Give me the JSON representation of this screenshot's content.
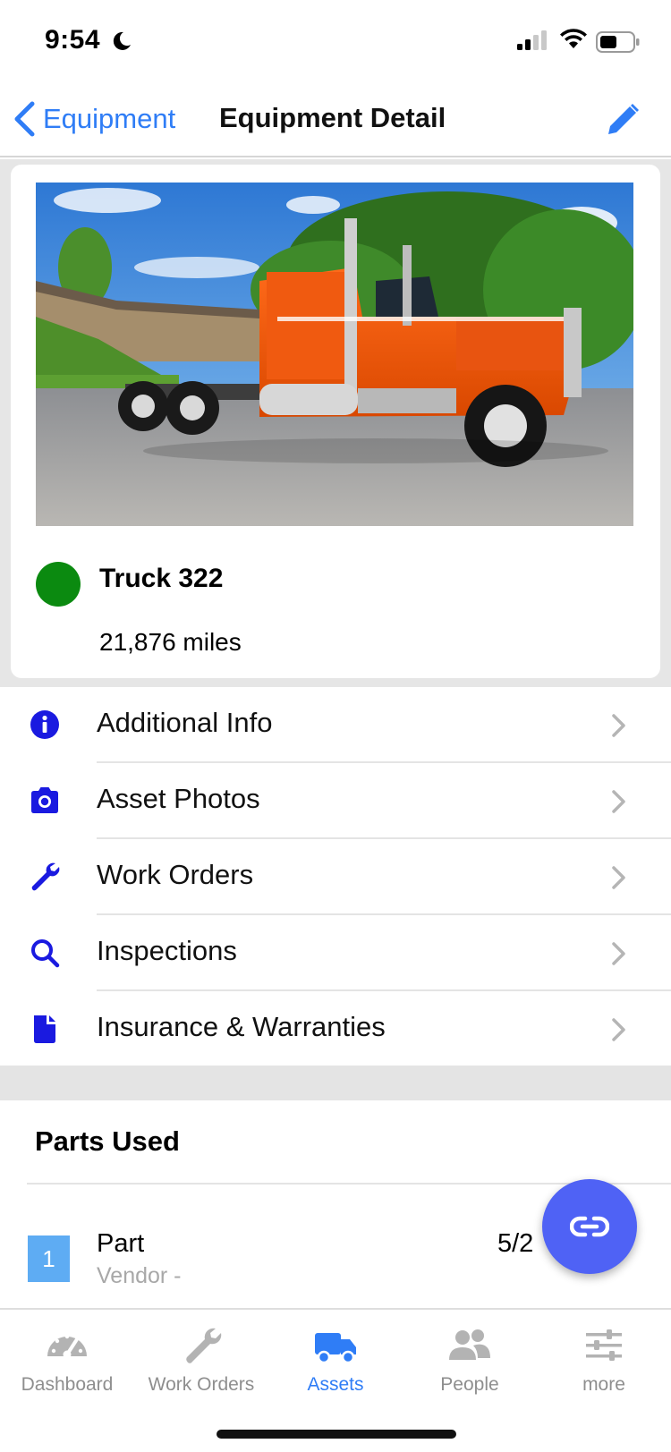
{
  "status_bar": {
    "time": "9:54"
  },
  "nav": {
    "back_label": "Equipment",
    "title": "Equipment Detail"
  },
  "asset": {
    "name": "Truck 322",
    "miles": "21,876 miles",
    "status_color": "#0b8a10"
  },
  "menu": {
    "items": [
      {
        "label": "Additional Info",
        "icon": "info-icon"
      },
      {
        "label": "Asset Photos",
        "icon": "camera-icon"
      },
      {
        "label": "Work Orders",
        "icon": "wrench-icon"
      },
      {
        "label": "Inspections",
        "icon": "search-icon"
      },
      {
        "label": "Insurance & Warranties",
        "icon": "document-icon"
      }
    ]
  },
  "parts": {
    "title": "Parts Used",
    "rows": [
      {
        "qty": "1",
        "name": "Part",
        "vendor": "Vendor -",
        "date": "5/2"
      }
    ]
  },
  "tabs": [
    {
      "label": "Dashboard",
      "icon": "speedometer-icon",
      "active": false
    },
    {
      "label": "Work Orders",
      "icon": "wrench-icon",
      "active": false
    },
    {
      "label": "Assets",
      "icon": "truck-icon",
      "active": true
    },
    {
      "label": "People",
      "icon": "people-icon",
      "active": false
    },
    {
      "label": "more",
      "icon": "sliders-icon",
      "active": false
    }
  ],
  "colors": {
    "accent": "#2f7df6",
    "menu_icon": "#1a1ae0",
    "fab": "#4f62f5",
    "qty_badge": "#5eacf3"
  }
}
